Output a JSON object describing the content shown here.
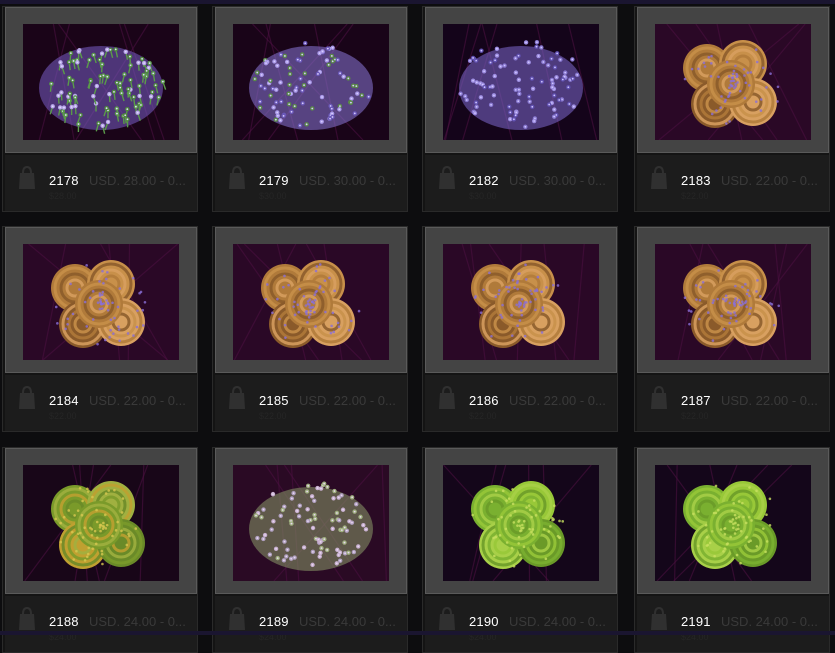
{
  "products": [
    {
      "sku": "2178",
      "price": "USD. 28.00 - 0...",
      "note": "$28.00",
      "palette": "green-purple"
    },
    {
      "sku": "2179",
      "price": "USD. 30.00 - 0...",
      "note": "$30.00",
      "palette": "lavender"
    },
    {
      "sku": "2182",
      "price": "USD. 30.00 - 0...",
      "note": "$30.00",
      "palette": "lavender-mound"
    },
    {
      "sku": "2183",
      "price": "USD. 22.00 - 0...",
      "note": "$22.00",
      "palette": "orange-hammer"
    },
    {
      "sku": "2184",
      "price": "USD. 22.00 - 0...",
      "note": "$22.00",
      "palette": "orange-hammer"
    },
    {
      "sku": "2185",
      "price": "USD. 22.00 - 0...",
      "note": "$22.00",
      "palette": "orange-hammer"
    },
    {
      "sku": "2186",
      "price": "USD. 22.00 - 0...",
      "note": "$22.00",
      "palette": "orange-hammer"
    },
    {
      "sku": "2187",
      "price": "USD. 22.00 - 0...",
      "note": "$22.00",
      "palette": "orange-hammer"
    },
    {
      "sku": "2188",
      "price": "USD. 24.00 - 0...",
      "note": "$24.00",
      "palette": "green-gold"
    },
    {
      "sku": "2189",
      "price": "USD. 24.00 - 0...",
      "note": "$24.00",
      "palette": "pastel-mix"
    },
    {
      "sku": "2190",
      "price": "USD. 24.00 - 0...",
      "note": "$24.00",
      "palette": "lime-green"
    },
    {
      "sku": "2191",
      "price": "USD. 24.00 - 0...",
      "note": "$24.00",
      "palette": "lime-green"
    }
  ],
  "icons": {
    "cart": "shopping-bag-icon"
  },
  "colors": {
    "background": "#0d0d0f",
    "card": "#1c1c1c",
    "frame": "#444444",
    "sku_text": "#ffffff",
    "price_text": "#3a3a3a"
  }
}
